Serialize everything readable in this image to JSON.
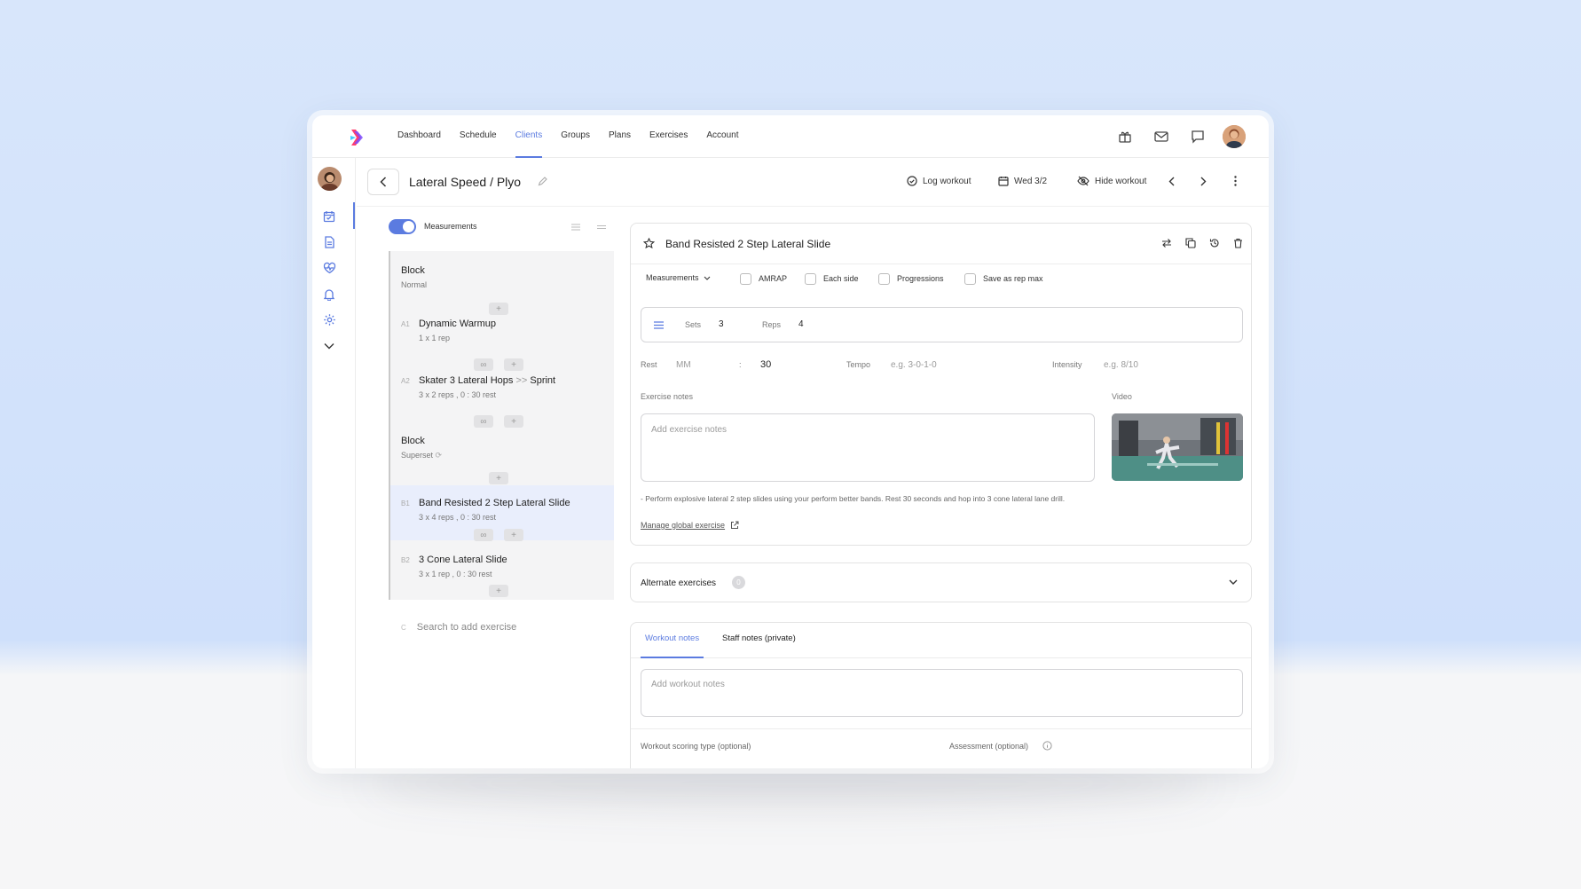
{
  "nav": {
    "items": [
      {
        "label": "Dashboard"
      },
      {
        "label": "Schedule"
      },
      {
        "label": "Clients",
        "active": true
      },
      {
        "label": "Groups"
      },
      {
        "label": "Plans"
      },
      {
        "label": "Exercises"
      },
      {
        "label": "Account"
      }
    ],
    "icons": [
      "gift-icon",
      "mail-icon",
      "chat-icon",
      "user-avatar"
    ]
  },
  "sidebar": {
    "icons": [
      "client-avatar",
      "calendar-check-icon",
      "document-icon",
      "heart-pulse-icon",
      "bell-icon",
      "gear-icon",
      "chevron-down-icon"
    ]
  },
  "header": {
    "title": "Lateral Speed / Plyo",
    "log_workout": "Log workout",
    "date": "Wed 3/2",
    "hide_workout": "Hide workout"
  },
  "left": {
    "toggle_label": "Measurements",
    "items": [
      {
        "kind": "block",
        "title": "Block",
        "sub": "Normal"
      },
      {
        "kind": "exercise",
        "num": "A1",
        "title": "Dynamic Warmup",
        "sub": "1 x 1 rep"
      },
      {
        "kind": "exercise",
        "num": "A2",
        "title_a": "Skater 3 Lateral Hops",
        "arrow": ">>",
        "title_b": "Sprint",
        "sub": "3 x 2 reps , 0 : 30 rest"
      },
      {
        "kind": "block",
        "title": "Block",
        "sub": "Superset"
      },
      {
        "kind": "exercise",
        "num": "B1",
        "title": "Band Resisted 2 Step Lateral Slide",
        "sub": "3 x 4 reps , 0 : 30 rest",
        "selected": true
      },
      {
        "kind": "exercise",
        "num": "B2",
        "title": "3 Cone Lateral Slide",
        "sub": "3 x 1 rep , 0 : 30 rest"
      }
    ],
    "search_placeholder": "Search to add exercise",
    "search_prefix": "C"
  },
  "exercise": {
    "name": "Band Resisted 2 Step Lateral Slide",
    "measurements_label": "Measurements",
    "options": [
      "AMRAP",
      "Each side",
      "Progressions",
      "Save as rep max"
    ],
    "sets_label": "Sets",
    "sets": "3",
    "reps_label": "Reps",
    "reps": "4",
    "rest_label": "Rest",
    "rest_mm": "MM",
    "rest_sep": ":",
    "rest_ss": "30",
    "tempo_label": "Tempo",
    "tempo_ph": "e.g. 3-0-1-0",
    "intensity_label": "Intensity",
    "intensity_ph": "e.g. 8/10",
    "notes_label": "Exercise notes",
    "notes_ph": "Add exercise notes",
    "video_label": "Video",
    "description": "- Perform explosive lateral 2 step slides using your perform better bands. Rest 30 seconds and hop into 3 cone lateral lane drill.",
    "manage_link": "Manage global exercise"
  },
  "alternates": {
    "label": "Alternate exercises",
    "count": "0"
  },
  "workout_notes": {
    "tabs": [
      "Workout notes",
      "Staff notes (private)"
    ],
    "placeholder": "Add workout notes",
    "scoring_label": "Workout scoring type (optional)",
    "assessment_label": "Assessment (optional)"
  },
  "colors": {
    "accent": "#5b7be0",
    "selected_row": "#e9eefc"
  }
}
